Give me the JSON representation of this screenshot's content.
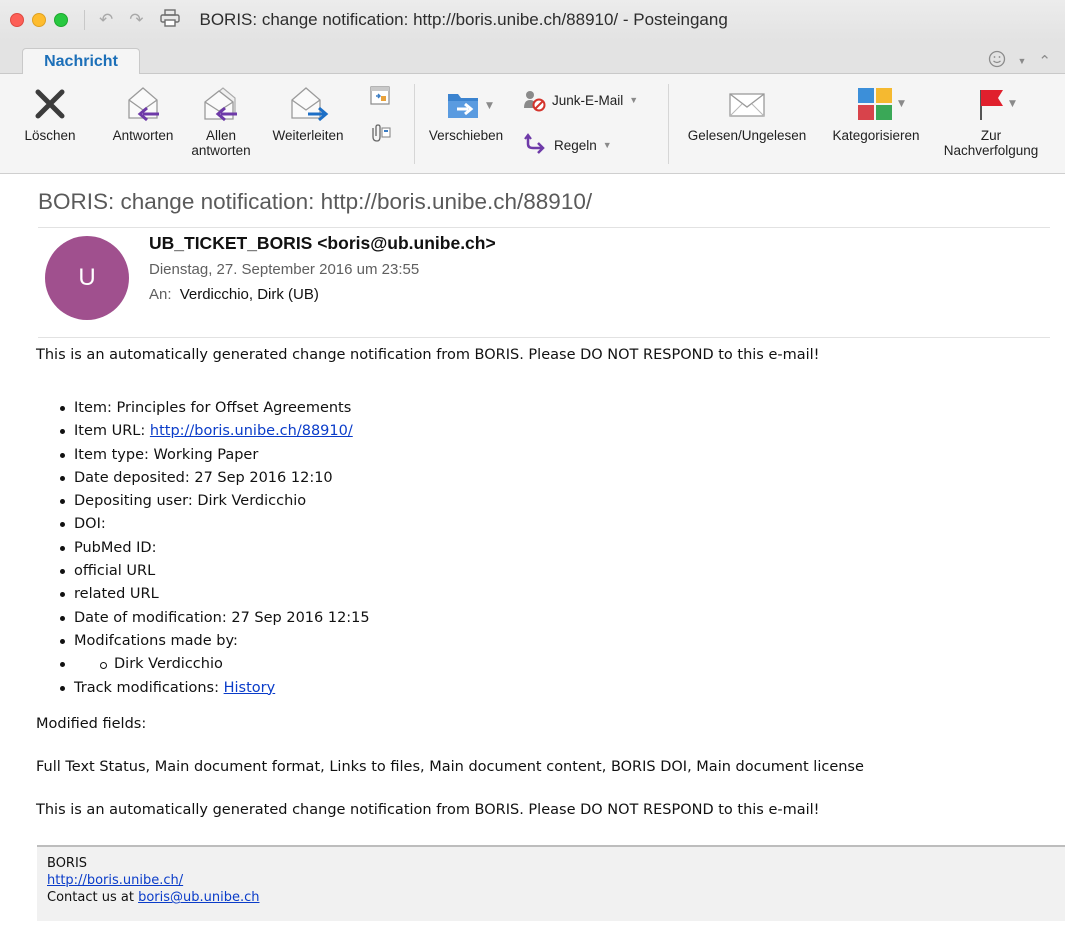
{
  "window": {
    "title": "BORIS: change notification: http://boris.unibe.ch/88910/  - Posteingang"
  },
  "tabs": {
    "active": "Nachricht"
  },
  "ribbon": {
    "delete": "Löschen",
    "reply": "Antworten",
    "reply_all_line1": "Allen",
    "reply_all_line2": "antworten",
    "forward": "Weiterleiten",
    "move": "Verschieben",
    "junk": "Junk-E-Mail",
    "rules": "Regeln",
    "read_unread": "Gelesen/Ungelesen",
    "categorize": "Kategorisieren",
    "followup_line1": "Zur",
    "followup_line2": "Nachverfolgung"
  },
  "message": {
    "subject": "BORIS: change notification: http://boris.unibe.ch/88910/",
    "avatar_initial": "U",
    "avatar_color": "#a0508e",
    "from": "UB_TICKET_BORIS <boris@ub.unibe.ch>",
    "date": "Dienstag, 27. September 2016 um 23:55",
    "to_label": "An:",
    "to": "Verdicchio, Dirk (UB)"
  },
  "body": {
    "intro": "This is an automatically generated change notification from BORIS. Please DO NOT RESPOND to this e-mail!",
    "items": {
      "item": "Item: Principles for Offset Agreements",
      "item_url_label": "Item URL: ",
      "item_url": "http://boris.unibe.ch/88910/",
      "item_type": "Item type: Working Paper",
      "date_deposited": "Date deposited: 27 Sep 2016 12:10",
      "depositing_user": "Depositing user: Dirk Verdicchio",
      "doi": "DOI:",
      "pubmed": "PubMed ID:",
      "official_url": "official URL",
      "related_url": "related URL",
      "date_modification": "Date of modification: 27 Sep 2016 12:15",
      "modifications_by": "Modifcations made by:",
      "modifier": "Dirk Verdicchio",
      "track_label": "Track modifications: ",
      "track_link": "History"
    },
    "modified_fields_label": "Modified fields:",
    "modified_fields": "Full Text Status, Main document format, Links to files, Main document content, BORIS DOI, Main document license",
    "outro": "This is an automatically generated change notification from BORIS. Please DO NOT RESPOND to this e-mail!"
  },
  "footer": {
    "name": "BORIS",
    "url": "http://boris.unibe.ch/",
    "contact_label": "Contact us at ",
    "contact_email": "boris@ub.unibe.ch"
  }
}
